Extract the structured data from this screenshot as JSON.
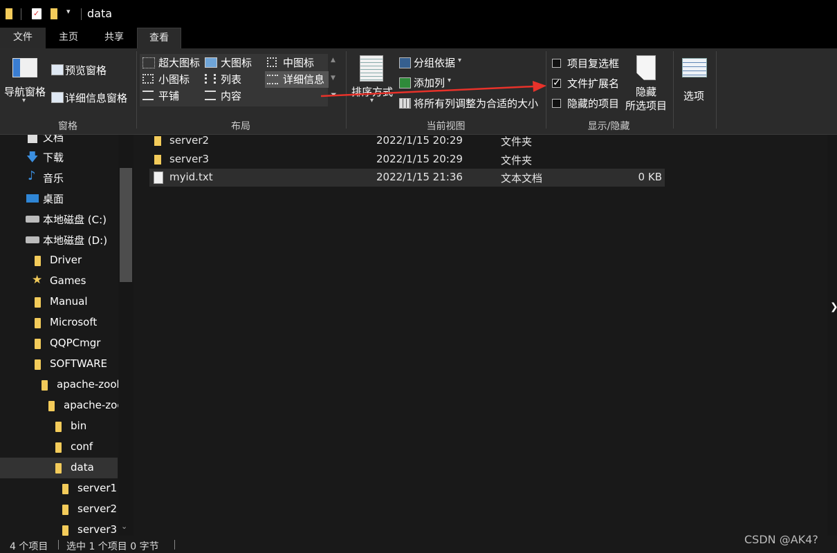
{
  "window": {
    "title": "data"
  },
  "tabs": [
    {
      "label": "文件"
    },
    {
      "label": "主页"
    },
    {
      "label": "共享"
    },
    {
      "label": "查看"
    }
  ],
  "ribbon": {
    "panes": {
      "nav_pane": "导航窗格",
      "preview_pane": "预览窗格",
      "details_pane": "详细信息窗格",
      "group_label": "窗格"
    },
    "layout": {
      "items": [
        "超大图标",
        "大图标",
        "中图标",
        "小图标",
        "列表",
        "详细信息",
        "平铺",
        "内容"
      ],
      "group_label": "布局"
    },
    "current_view": {
      "sort_by": "排序方式",
      "group_by": "分组依据",
      "add_column": "添加列",
      "size_columns": "将所有列调整为合适的大小",
      "group_label": "当前视图"
    },
    "show_hide": {
      "item_checkboxes": {
        "label": "项目复选框",
        "checked": false
      },
      "file_extensions": {
        "label": "文件扩展名",
        "checked": true
      },
      "hidden_items": {
        "label": "隐藏的项目",
        "checked": false
      },
      "hide_selected_line1": "隐藏",
      "hide_selected_line2": "所选项目",
      "group_label": "显示/隐藏"
    },
    "options": "选项"
  },
  "nav": {
    "items": [
      {
        "label": "文档"
      },
      {
        "label": "下载"
      },
      {
        "label": "音乐"
      },
      {
        "label": "桌面"
      },
      {
        "label": "本地磁盘 (C:)"
      },
      {
        "label": "本地磁盘 (D:)"
      },
      {
        "label": "Driver"
      },
      {
        "label": "Games"
      },
      {
        "label": "Manual"
      },
      {
        "label": "Microsoft"
      },
      {
        "label": "QQPCmgr"
      },
      {
        "label": "SOFTWARE"
      },
      {
        "label": "apache-zook"
      },
      {
        "label": "apache-zoo"
      },
      {
        "label": "bin"
      },
      {
        "label": "conf"
      },
      {
        "label": "data"
      },
      {
        "label": "server1"
      },
      {
        "label": "server2"
      },
      {
        "label": "server3"
      }
    ]
  },
  "files": [
    {
      "name": "server2",
      "date": "2022/1/15 20:29",
      "type": "文件夹",
      "size": ""
    },
    {
      "name": "server3",
      "date": "2022/1/15 20:29",
      "type": "文件夹",
      "size": ""
    },
    {
      "name": "myid.txt",
      "date": "2022/1/15 21:36",
      "type": "文本文档",
      "size": "0 KB"
    }
  ],
  "status": {
    "count": "4 个项目",
    "selection": "选中 1 个项目 0 字节"
  },
  "watermark": "CSDN @AK4?",
  "colors": {
    "folder": "#f3cb5a",
    "arrow": "#e8322a",
    "background": "#191919"
  }
}
